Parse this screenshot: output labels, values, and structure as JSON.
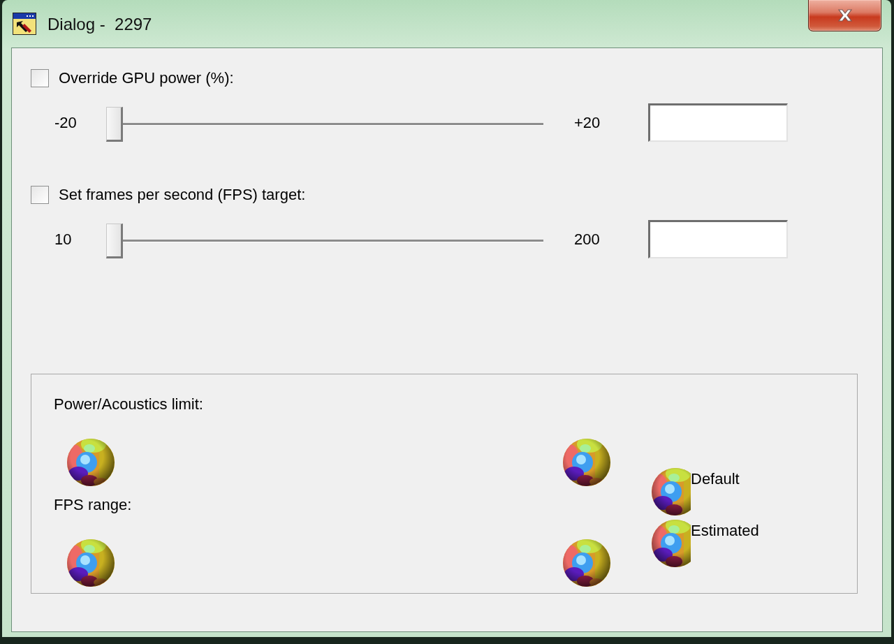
{
  "window": {
    "title": "Dialog -  2297"
  },
  "sections": [
    {
      "checkbox": {
        "label": "Override GPU power (%):",
        "checked": false
      },
      "slider": {
        "min_label": "-20",
        "max_label": "+20",
        "level": 0
      }
    },
    {
      "checkbox": {
        "label": "Set frames per second (FPS) target:",
        "checked": false
      },
      "slider": {
        "min_label": "10",
        "max_label": "200",
        "level": 0
      }
    }
  ],
  "group": {
    "rows": [
      {
        "label": "Power/Acoustics limit:"
      },
      {
        "label": "FPS range:"
      }
    ],
    "legend": [
      {
        "label": "Default"
      },
      {
        "label": "Estimated"
      }
    ]
  }
}
